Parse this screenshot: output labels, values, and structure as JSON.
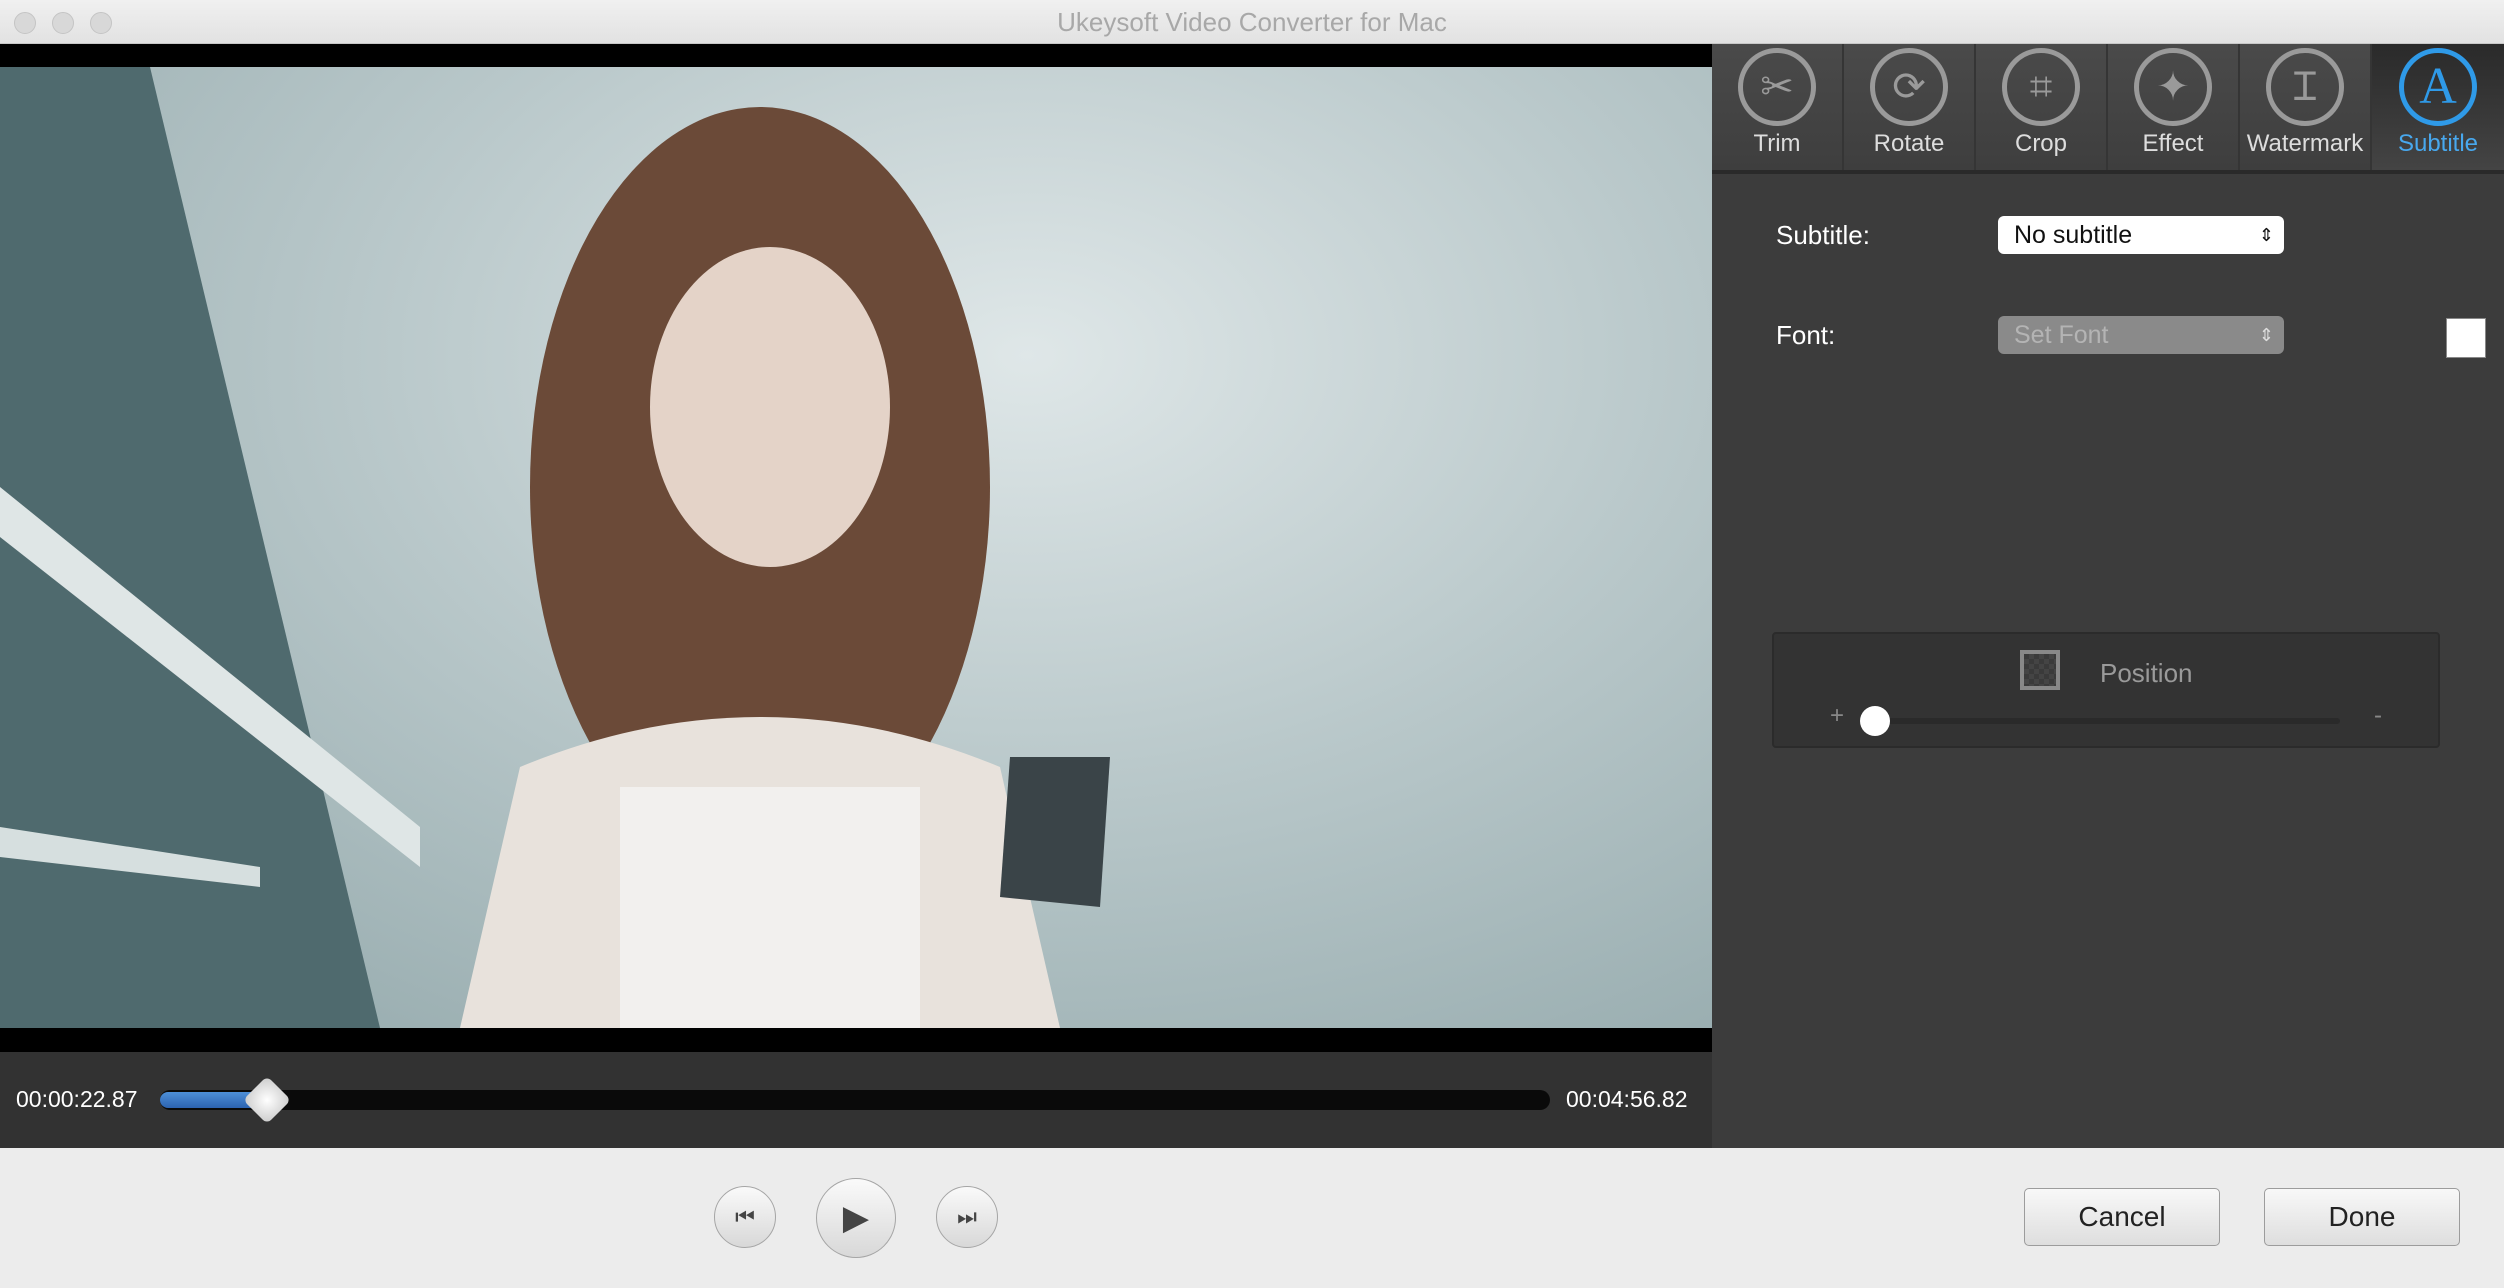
{
  "window": {
    "title": "Ukeysoft Video Converter for Mac"
  },
  "player": {
    "current_time": "00:00:22.87",
    "total_time": "00:04:56.82",
    "progress_percent": 7.7
  },
  "tabs": [
    {
      "label": "Trim",
      "icon": "scissors-icon",
      "glyph": "✂"
    },
    {
      "label": "Rotate",
      "icon": "rotate-icon",
      "glyph": "⟳"
    },
    {
      "label": "Crop",
      "icon": "crop-icon",
      "glyph": "⌗"
    },
    {
      "label": "Effect",
      "icon": "magic-wand-icon",
      "glyph": "✦"
    },
    {
      "label": "Watermark",
      "icon": "watermark-icon",
      "glyph": "Ɪ"
    },
    {
      "label": "Subtitle",
      "icon": "subtitle-icon",
      "glyph": "A",
      "active": true
    }
  ],
  "subtitle": {
    "subtitle_label": "Subtitle:",
    "subtitle_value": "No subtitle",
    "font_label": "Font:",
    "font_value": "Set Font",
    "font_color": "#ffffff",
    "position_label": "Position",
    "plus": "+",
    "minus": "-",
    "position_value": 0
  },
  "controls": {
    "cancel": "Cancel",
    "done": "Done"
  },
  "colors": {
    "accent": "#2f9ae8",
    "progress": "#3a78c8"
  }
}
